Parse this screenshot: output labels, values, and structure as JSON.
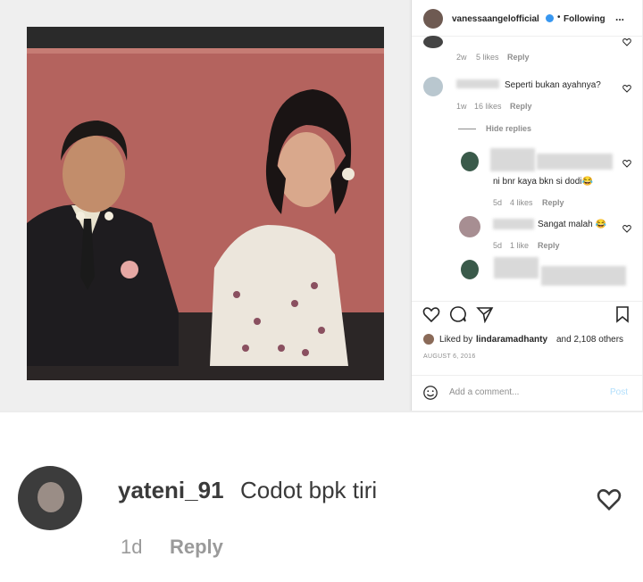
{
  "header": {
    "username": "vanessaangelofficial",
    "separator": "•",
    "follow_status": "Following",
    "more": "..."
  },
  "comments": [
    {
      "time": "2w",
      "likes": "5 likes",
      "reply": "Reply"
    },
    {
      "text": "Seperti bukan ayahnya?",
      "time": "1w",
      "likes": "16 likes",
      "reply": "Reply",
      "hide_replies": "Hide replies"
    },
    {
      "text": "ni bnr kaya bkn si dodi😂",
      "time": "5d",
      "likes": "4 likes",
      "reply": "Reply"
    },
    {
      "text": "Sangat malah 😂",
      "time": "5d",
      "likes": "1 like",
      "reply": "Reply"
    }
  ],
  "liked_by": {
    "prefix": "Liked by",
    "user": "lindaramadhanty",
    "suffix": "and 2,108 others"
  },
  "date": "AUGUST 6, 2016",
  "add_comment": {
    "placeholder": "Add a comment...",
    "post": "Post"
  },
  "bottom": {
    "username": "yateni_91",
    "text": "Codot bpk tiri",
    "time": "1d",
    "reply": "Reply"
  }
}
